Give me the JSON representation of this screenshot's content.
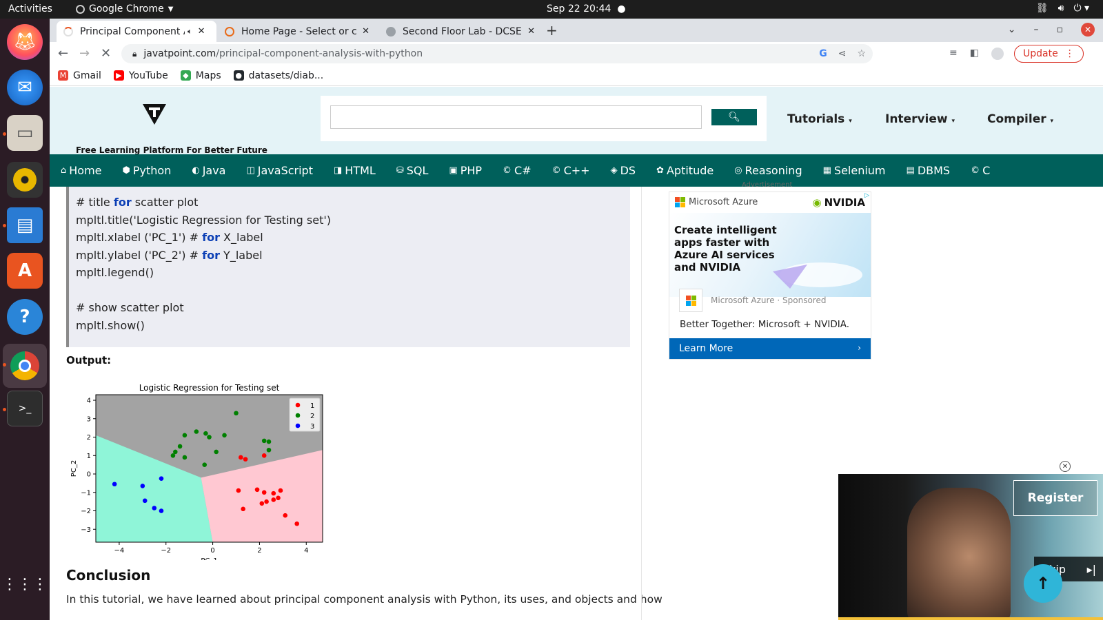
{
  "topbar": {
    "activities": "Activities",
    "app_name": "Google Chrome",
    "clock": "Sep 22  20:44"
  },
  "dock": {
    "items": [
      "firefox-icon",
      "thunderbird-icon",
      "files-icon",
      "rhythmbox-icon",
      "writer-icon",
      "software-icon",
      "help-icon",
      "chrome-icon",
      "terminal-icon",
      "apps-grid-icon"
    ]
  },
  "tabs": [
    {
      "title": "Principal Component A",
      "active": true
    },
    {
      "title": "Home Page - Select or cre",
      "active": false
    },
    {
      "title": "Second Floor Lab - DCSE",
      "active": false
    }
  ],
  "omnibox": {
    "host": "javatpoint.com",
    "path": "/principal-component-analysis-with-python"
  },
  "update_label": "Update",
  "bookmarks": [
    {
      "label": "Gmail",
      "icon": "gmail-icon",
      "color": "#ea4335"
    },
    {
      "label": "YouTube",
      "icon": "youtube-icon",
      "color": "#ff0000"
    },
    {
      "label": "Maps",
      "icon": "maps-icon",
      "color": "#34a853"
    },
    {
      "label": "datasets/diab...",
      "icon": "github-icon",
      "color": "#24292e"
    }
  ],
  "site": {
    "tagline": "Free Learning Platform For Better Future",
    "menus": [
      "Tutorials",
      "Interview",
      "Compiler"
    ],
    "nav": [
      "Home",
      "Python",
      "Java",
      "JavaScript",
      "HTML",
      "SQL",
      "PHP",
      "C#",
      "C++",
      "DS",
      "Aptitude",
      "Reasoning",
      "Selenium",
      "DBMS",
      "C"
    ]
  },
  "code": {
    "lines": [
      [
        "# title ",
        {
          "kw": "for"
        },
        " scatter plot"
      ],
      [
        "mpltl.title('Logistic Regression for Testing set')"
      ],
      [
        "mpltl.xlabel ('PC_1') # ",
        {
          "kw": "for"
        },
        " X_label"
      ],
      [
        "mpltl.ylabel ('PC_2') # ",
        {
          "kw": "for"
        },
        " Y_label"
      ],
      [
        "mpltl.legend()"
      ],
      [
        ""
      ],
      [
        "# show scatter plot"
      ],
      [
        "mpltl.show()"
      ]
    ]
  },
  "output_label": "Output:",
  "chart_data": {
    "type": "scatter",
    "title": "Logistic Regression for Testing set",
    "xlabel": "PC_1",
    "ylabel": "PC_2",
    "xlim": [
      -5,
      4.7
    ],
    "ylim": [
      -3.7,
      4.3
    ],
    "xticks": [
      -4,
      -2,
      0,
      2,
      4
    ],
    "yticks": [
      -3,
      -2,
      -1,
      0,
      1,
      2,
      3,
      4
    ],
    "legend_position": "top-right",
    "regions": [
      {
        "class": "2",
        "color": "#a3a3a3"
      },
      {
        "class": "3",
        "color": "#8ff5d8"
      },
      {
        "class": "1",
        "color": "#ffc8d2"
      }
    ],
    "series": [
      {
        "name": "1",
        "color": "#ff0000",
        "points": [
          [
            1.2,
            0.9
          ],
          [
            1.4,
            0.8
          ],
          [
            2.2,
            1.0
          ],
          [
            1.1,
            -0.9
          ],
          [
            1.3,
            -1.9
          ],
          [
            1.9,
            -0.85
          ],
          [
            2.2,
            -1.0
          ],
          [
            2.1,
            -1.6
          ],
          [
            2.3,
            -1.5
          ],
          [
            2.6,
            -1.4
          ],
          [
            2.6,
            -1.05
          ],
          [
            2.8,
            -1.3
          ],
          [
            2.9,
            -0.9
          ],
          [
            3.1,
            -2.25
          ],
          [
            3.6,
            -2.7
          ]
        ]
      },
      {
        "name": "2",
        "color": "#008000",
        "points": [
          [
            1.0,
            3.3
          ],
          [
            -1.2,
            2.1
          ],
          [
            -0.7,
            2.3
          ],
          [
            -0.3,
            2.2
          ],
          [
            -0.15,
            2.0
          ],
          [
            0.5,
            2.1
          ],
          [
            -1.4,
            1.5
          ],
          [
            -1.6,
            1.2
          ],
          [
            -1.7,
            1.0
          ],
          [
            -1.2,
            0.9
          ],
          [
            0.15,
            1.2
          ],
          [
            -0.35,
            0.5
          ],
          [
            2.2,
            1.8
          ],
          [
            2.4,
            1.75
          ],
          [
            2.4,
            1.3
          ]
        ]
      },
      {
        "name": "3",
        "color": "#0000ff",
        "points": [
          [
            -4.2,
            -0.55
          ],
          [
            -3.0,
            -0.65
          ],
          [
            -2.2,
            -0.25
          ],
          [
            -2.9,
            -1.45
          ],
          [
            -2.5,
            -1.85
          ],
          [
            -2.2,
            -2.0
          ]
        ]
      }
    ]
  },
  "conclusion": {
    "heading": "Conclusion",
    "text": "In this tutorial, we have learned about principal component analysis with Python, its uses, and objects and how"
  },
  "ad": {
    "label": "Advertisement",
    "brand": "Microsoft Azure",
    "partner": "NVIDIA",
    "headline": "Create intelligent apps faster with Azure AI services and NVIDIA",
    "sponsor": "Microsoft Azure · Sponsored",
    "body": "Better Together: Microsoft + NVIDIA.",
    "cta": "Learn More"
  },
  "video": {
    "register": "Register",
    "skip": "Skip"
  }
}
